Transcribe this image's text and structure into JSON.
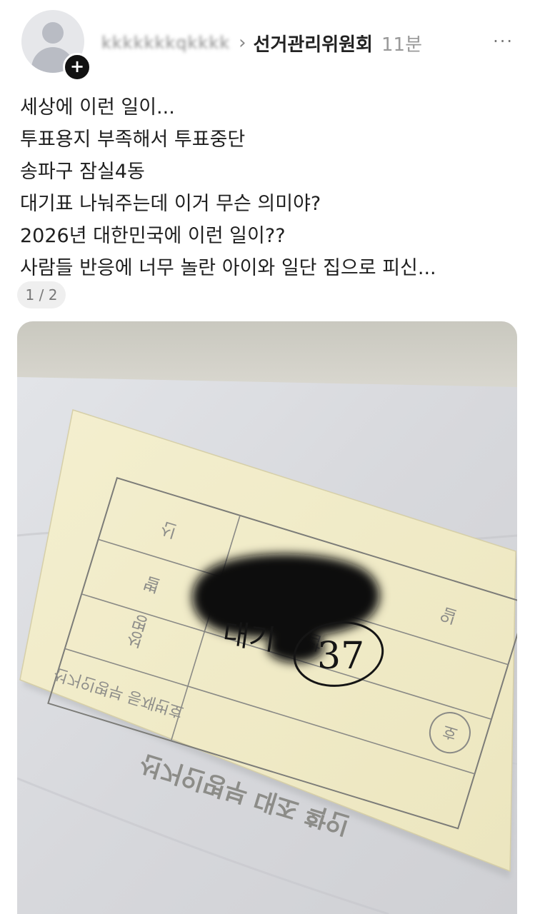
{
  "header": {
    "username": "kkkkkkkqkkkk",
    "community": "선거관리위원회",
    "time": "11분",
    "more_label": "···",
    "follow_label": "+"
  },
  "post": {
    "lines": [
      "세상에 이런 일이...",
      "투표용지 부족해서 투표중단",
      "송파구 잠실4동",
      "대기표 나눠주는데 이거 무슨 의미야?",
      "2026년 대한민국에 이런 일이??",
      "사람들 반응에 너무 놀란 아이와 일단 집으로 피신..."
    ],
    "image_counter": "1 / 2"
  },
  "photo": {
    "ticket_title": "선거인명부 대조 확인",
    "ticket_row1": "선거인명부 등재번호",
    "ticket_label_ho": "호",
    "ticket_label_seong": "성",
    "ticket_label_myeong": "명",
    "ticket_label_byeol": "별",
    "ticket_label_il": "일",
    "ticket_label_sin": "신",
    "ticket_label_nap": "납",
    "handwritten_wait": "대기",
    "handwritten_number": "37"
  },
  "colors": {
    "ticket_paper": "#f1ecc9",
    "background_paper": "#d9dadd",
    "ink": "#151515"
  }
}
